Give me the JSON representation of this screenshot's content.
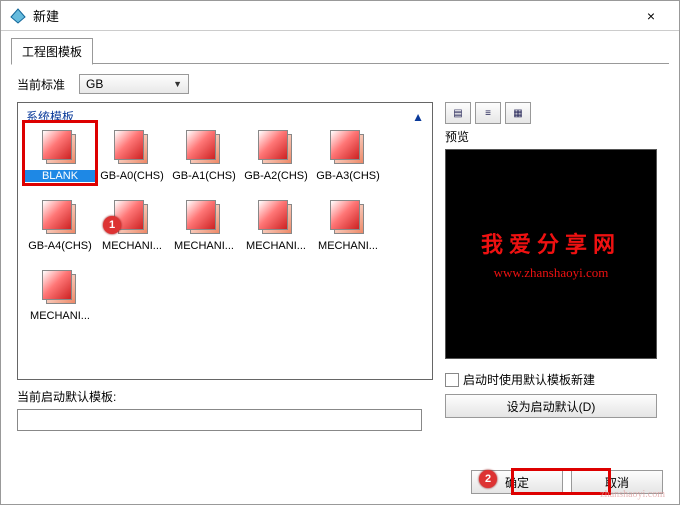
{
  "window": {
    "title": "新建",
    "close_icon": "×"
  },
  "tab": {
    "drawing_template": "工程图模板"
  },
  "standard_label": "当前标准",
  "standard_value": "GB",
  "sys_template_header": "系统模板",
  "templates": [
    {
      "label": "BLANK",
      "selected": true
    },
    {
      "label": "GB-A0(CHS)"
    },
    {
      "label": "GB-A1(CHS)"
    },
    {
      "label": "GB-A2(CHS)"
    },
    {
      "label": "GB-A3(CHS)"
    },
    {
      "label": "GB-A4(CHS)"
    },
    {
      "label": "MECHANI..."
    },
    {
      "label": "MECHANI..."
    },
    {
      "label": "MECHANI..."
    },
    {
      "label": "MECHANI..."
    },
    {
      "label": "MECHANI..."
    }
  ],
  "default_template_label": "当前启动默认模板:",
  "view_icons": [
    "large-icons-view",
    "list-view",
    "details-view"
  ],
  "preview_label": "预览",
  "preview": {
    "cn": "我爱分享网",
    "url": "www.zhanshaoyi.com"
  },
  "use_default_on_new": "启动时使用默认模板新建",
  "set_default_btn": "设为启动默认(D)",
  "ok_btn": "确定",
  "cancel_btn": "取消",
  "badges": {
    "one": "1",
    "two": "2"
  },
  "watermark": "zhanshaoyi.com"
}
